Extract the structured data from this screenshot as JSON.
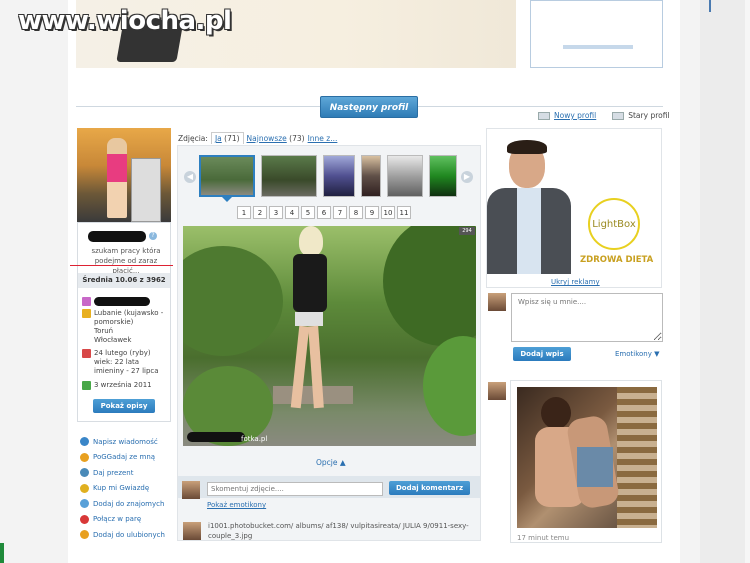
{
  "watermark": "www.wiocha.pl",
  "next_profile_button": "Następny profil",
  "view_switch": {
    "new": "Nowy profil",
    "old": "Stary profil"
  },
  "profile": {
    "status_line1": "szukam pracy która",
    "status_line2": "podejme od zaraz płacić...",
    "average": "Średnia 10.06 z 3962",
    "location": [
      "Lubanie (kujawsko -",
      "pomorskie)",
      "Toruń",
      "Włocławek"
    ],
    "birthday": [
      "24 lutego (ryby)",
      "wiek: 22 lata",
      "imieniny - 27 lipca"
    ],
    "joined": "3 września 2011",
    "describe_button": "Pokaż opisy"
  },
  "actions": [
    {
      "label": "Napisz wiadomość",
      "color": "#3a86c8"
    },
    {
      "label": "PoGGadaj ze mną",
      "color": "#e8a020"
    },
    {
      "label": "Daj prezent",
      "color": "#4a8ab8"
    },
    {
      "label": "Kup mi Gwiazdę",
      "color": "#e0b020"
    },
    {
      "label": "Dodaj do znajomych",
      "color": "#58a0d8"
    },
    {
      "label": "Połącz w parę",
      "color": "#d83838"
    },
    {
      "label": "Dodaj do ulubionych",
      "color": "#e8a020"
    }
  ],
  "photos": {
    "label": "Zdjęcia:",
    "tab_me": "Ja",
    "tab_me_count": "(71)",
    "tab_newest": "Najnowsze",
    "tab_newest_count": "(73)",
    "tab_others": "Inne z...",
    "pages": [
      "1",
      "2",
      "3",
      "4",
      "5",
      "6",
      "7",
      "8",
      "9",
      "10",
      "11"
    ],
    "caption": "fotka.pl",
    "badge": "294",
    "options": "Opcje ▲"
  },
  "comment": {
    "placeholder": "Skomentuj zdjęcie....",
    "button": "Dodaj komentarz",
    "emoticons_link": "Pokaż emotikony",
    "entry_text": "i1001.photobucket.com/ albums/ af138/ vulpitasireata/ JULIA 9/0911-sexy-couple_3.jpg"
  },
  "ad": {
    "logo": "LightBox",
    "tagline": "ZDROWA DIETA",
    "hide_link": "Ukryj reklamy"
  },
  "guestbook": {
    "placeholder": "Wpisz się u mnie....",
    "add_button": "Dodaj wpis",
    "emoticons": "Emotikony ▼",
    "entry_time": "17 minut temu"
  }
}
